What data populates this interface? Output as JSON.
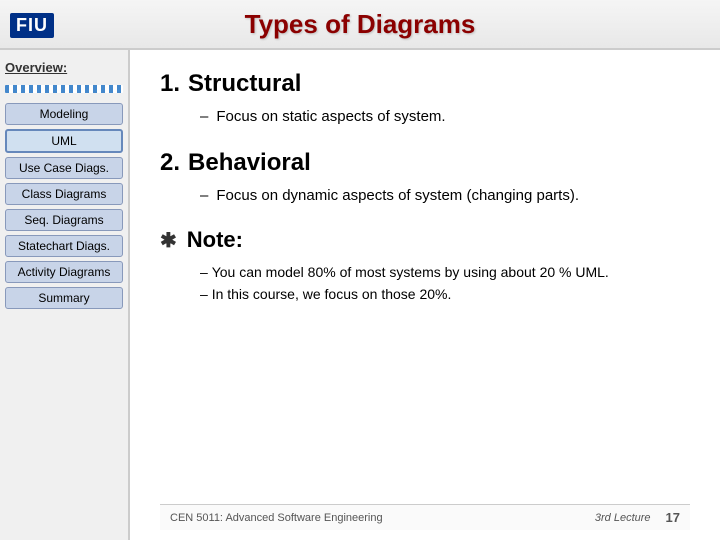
{
  "header": {
    "title": "Types of Diagrams",
    "logo_text": "FIU"
  },
  "sidebar": {
    "overview_label": "Overview:",
    "stripe_visible": true,
    "items": [
      {
        "id": "modeling",
        "label": "Modeling",
        "active": false
      },
      {
        "id": "uml",
        "label": "UML",
        "active": true
      },
      {
        "id": "use-case-diags",
        "label": "Use Case Diags.",
        "active": false
      },
      {
        "id": "class-diagrams",
        "label": "Class Diagrams",
        "active": false
      },
      {
        "id": "seq-diagrams",
        "label": "Seq. Diagrams",
        "active": false
      },
      {
        "id": "statechart-diags",
        "label": "Statechart Diags.",
        "active": false
      },
      {
        "id": "activity-diagrams",
        "label": "Activity Diagrams",
        "active": false
      },
      {
        "id": "summary",
        "label": "Summary",
        "active": false
      }
    ]
  },
  "content": {
    "section1": {
      "number": "1.",
      "title": "Structural",
      "bullet": "Focus on static aspects of system."
    },
    "section2": {
      "number": "2.",
      "title": "Behavioral",
      "bullet": "Focus on dynamic aspects of system (changing parts)."
    },
    "note": {
      "symbol": "✱",
      "title": "Note:",
      "bullet1_dash": "–",
      "bullet1": "You can model 80% of most systems by using about 20 % UML.",
      "bullet2_dash": "–",
      "bullet2": "In this course, we focus on those 20%."
    }
  },
  "footer": {
    "course": "CEN 5011: Advanced Software Engineering",
    "lecture": "3rd Lecture",
    "page": "17"
  }
}
